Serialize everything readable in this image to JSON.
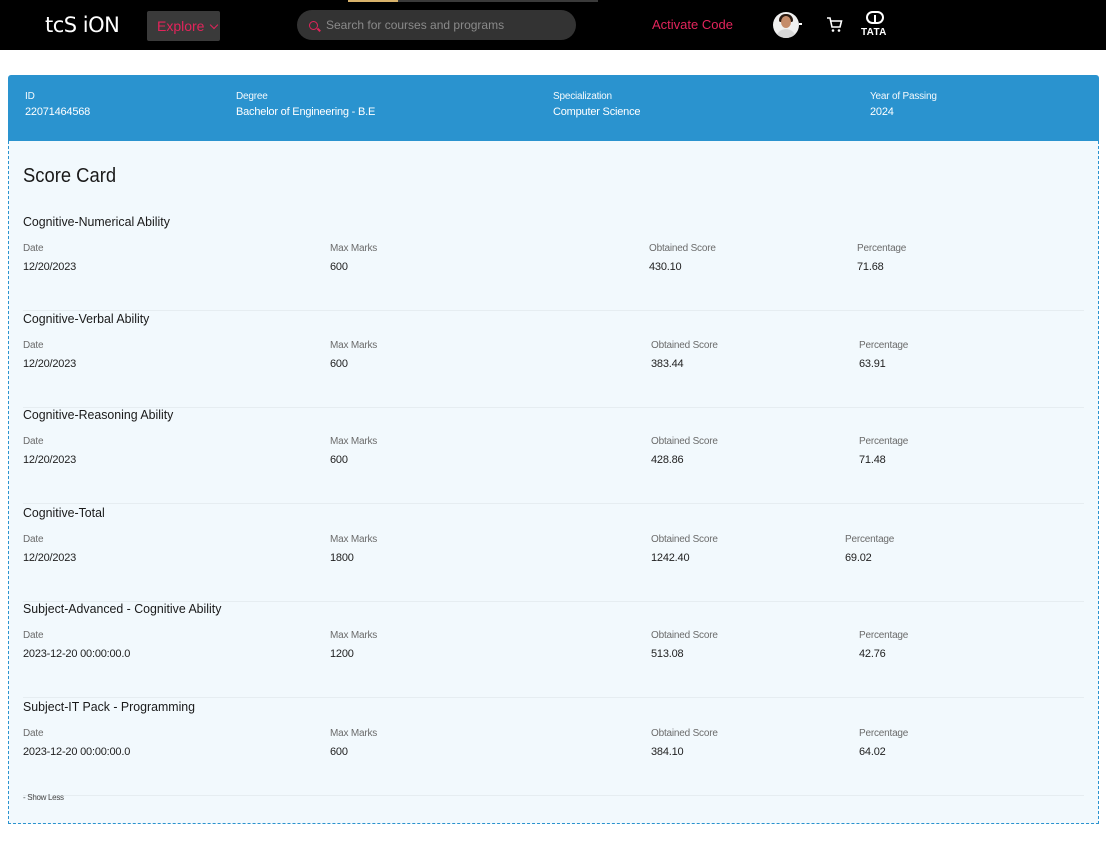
{
  "header": {
    "logo_text": "tcS iON",
    "explore_label": "Explore",
    "search_placeholder": "Search for courses and programs",
    "activate_label": "Activate Code",
    "tata_label": "TATA",
    "icons": [
      "search-icon",
      "chevron-down-icon",
      "avatar",
      "cart-icon",
      "tata-logo"
    ]
  },
  "profile": {
    "id_label": "ID",
    "id_value": "22071464568",
    "degree_label": "Degree",
    "degree_value": "Bachelor of Engineering - B.E",
    "specialization_label": "Specialization",
    "specialization_value": "Computer Science",
    "year_label": "Year of Passing",
    "year_value": "2024"
  },
  "scorecard": {
    "title": "Score Card",
    "field_labels": {
      "date": "Date",
      "max_marks": "Max Marks",
      "obtained": "Obtained Score",
      "percentage": "Percentage"
    },
    "sections": [
      {
        "name": "Cognitive-Numerical Ability",
        "date": "12/20/2023",
        "max_marks": "600",
        "obtained": "430.10",
        "percentage": "71.68"
      },
      {
        "name": "Cognitive-Verbal Ability",
        "date": "12/20/2023",
        "max_marks": "600",
        "obtained": "383.44",
        "percentage": "63.91"
      },
      {
        "name": "Cognitive-Reasoning Ability",
        "date": "12/20/2023",
        "max_marks": "600",
        "obtained": "428.86",
        "percentage": "71.48"
      },
      {
        "name": "Cognitive-Total",
        "date": "12/20/2023",
        "max_marks": "1800",
        "obtained": "1242.40",
        "percentage": "69.02"
      },
      {
        "name": "Subject-Advanced - Cognitive Ability",
        "date": "2023-12-20 00:00:00.0",
        "max_marks": "1200",
        "obtained": "513.08",
        "percentage": "42.76"
      },
      {
        "name": "Subject-IT Pack - Programming",
        "date": "2023-12-20 00:00:00.0",
        "max_marks": "600",
        "obtained": "384.10",
        "percentage": "64.02"
      }
    ],
    "show_less_label": "- Show Less"
  },
  "colors": {
    "topbar": "#000000",
    "accent_pink": "#e2245b",
    "banner_blue": "#2a93cf",
    "panel_bg": "#f2f9fd"
  }
}
